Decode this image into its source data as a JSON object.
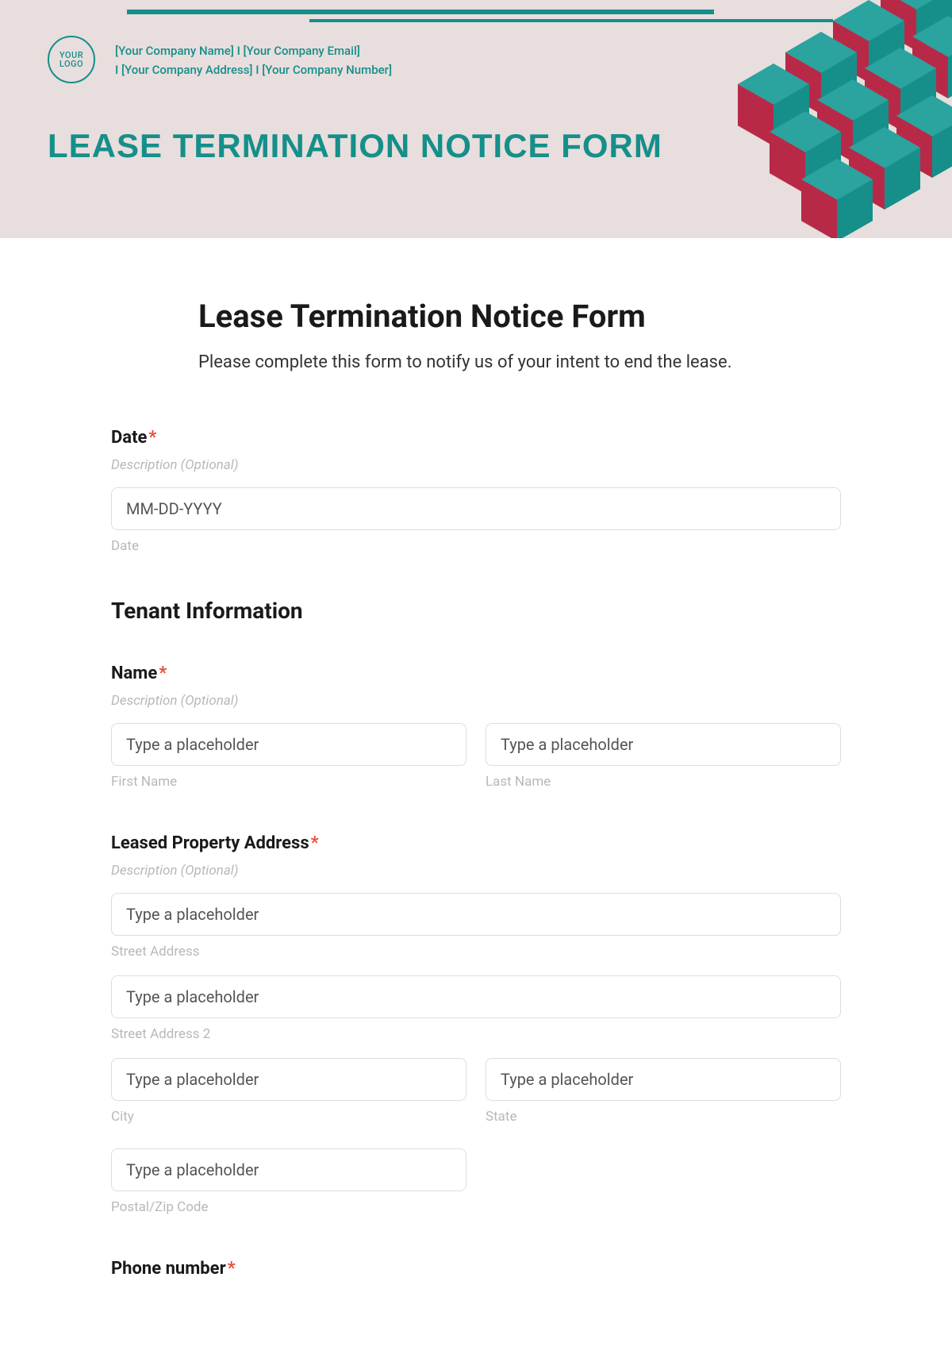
{
  "header": {
    "logo_line1": "YOUR",
    "logo_line2": "LOGO",
    "company_line1": "[Your Company Name] I [Your Company Email]",
    "company_line2": "I [Your Company Address] I [Your Company Number]",
    "banner_title": "LEASE TERMINATION NOTICE FORM"
  },
  "form": {
    "title": "Lease Termination Notice Form",
    "subtitle": "Please complete this form to notify us of your intent to end the lease.",
    "date": {
      "label": "Date",
      "description": "Description (Optional)",
      "placeholder": "MM-DD-YYYY",
      "sublabel": "Date"
    },
    "tenant_section": "Tenant Information",
    "name": {
      "label": "Name",
      "description": "Description (Optional)",
      "first_placeholder": "Type a placeholder",
      "first_sublabel": "First Name",
      "last_placeholder": "Type a placeholder",
      "last_sublabel": "Last Name"
    },
    "address": {
      "label": "Leased Property Address",
      "description": "Description (Optional)",
      "street_placeholder": "Type a placeholder",
      "street_sublabel": "Street Address",
      "street2_placeholder": "Type a placeholder",
      "street2_sublabel": "Street Address 2",
      "city_placeholder": "Type a placeholder",
      "city_sublabel": "City",
      "state_placeholder": "Type a placeholder",
      "state_sublabel": "State",
      "postal_placeholder": "Type a placeholder",
      "postal_sublabel": "Postal/Zip Code"
    },
    "phone": {
      "label": "Phone number"
    }
  }
}
